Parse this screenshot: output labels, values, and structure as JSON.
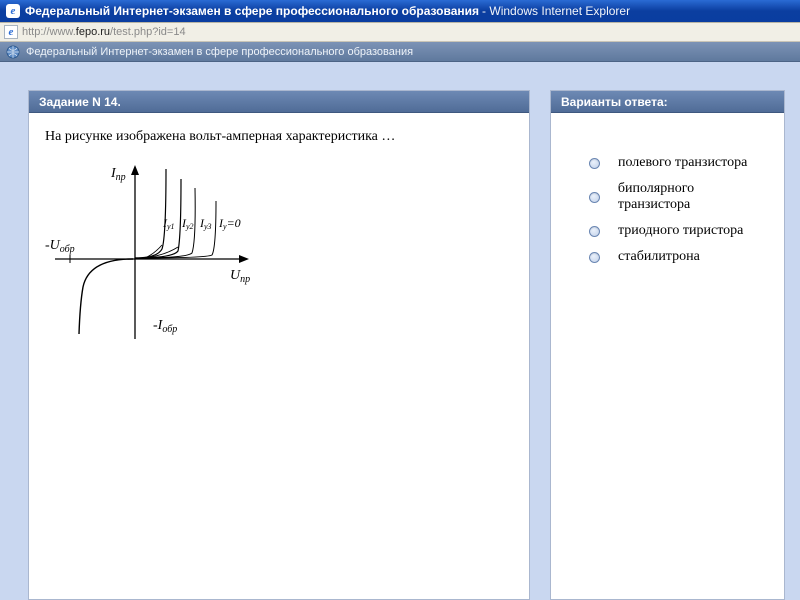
{
  "window": {
    "title_main": "Федеральный Интернет-экзамен в сфере профессионального образования",
    "title_suffix": "- Windows Internet Explorer"
  },
  "address": {
    "url_prefix": "http://www.",
    "url_domain": "fepo.ru",
    "url_path": "/test.php?id=14"
  },
  "sitebar": {
    "label": "Федеральный Интернет-экзамен в сфере профессионального образования"
  },
  "question": {
    "header": "Задание N 14.",
    "text": "На рисунке изображена вольт-амперная характеристика …",
    "diagram_labels": {
      "i_pr": "I",
      "i_pr_sub": "пр",
      "u_pr": "U",
      "u_pr_sub": "пр",
      "neg_u_obr": "-U",
      "u_obr_sub": "обр",
      "neg_i_obr": "-I",
      "i_obr_sub": "обр",
      "iy1": "I",
      "iy1_sub": "у1",
      "iy2": "I",
      "iy2_sub": "у2",
      "iy3": "I",
      "iy3_sub": "у3",
      "iy0": "I",
      "iy0_sub": "у",
      "iy0_eq": "=0"
    }
  },
  "answers": {
    "header": "Варианты ответа:",
    "options": [
      "полевого транзистора",
      "биполярного транзистора",
      "триодного тиристора",
      "стабилитрона"
    ]
  }
}
